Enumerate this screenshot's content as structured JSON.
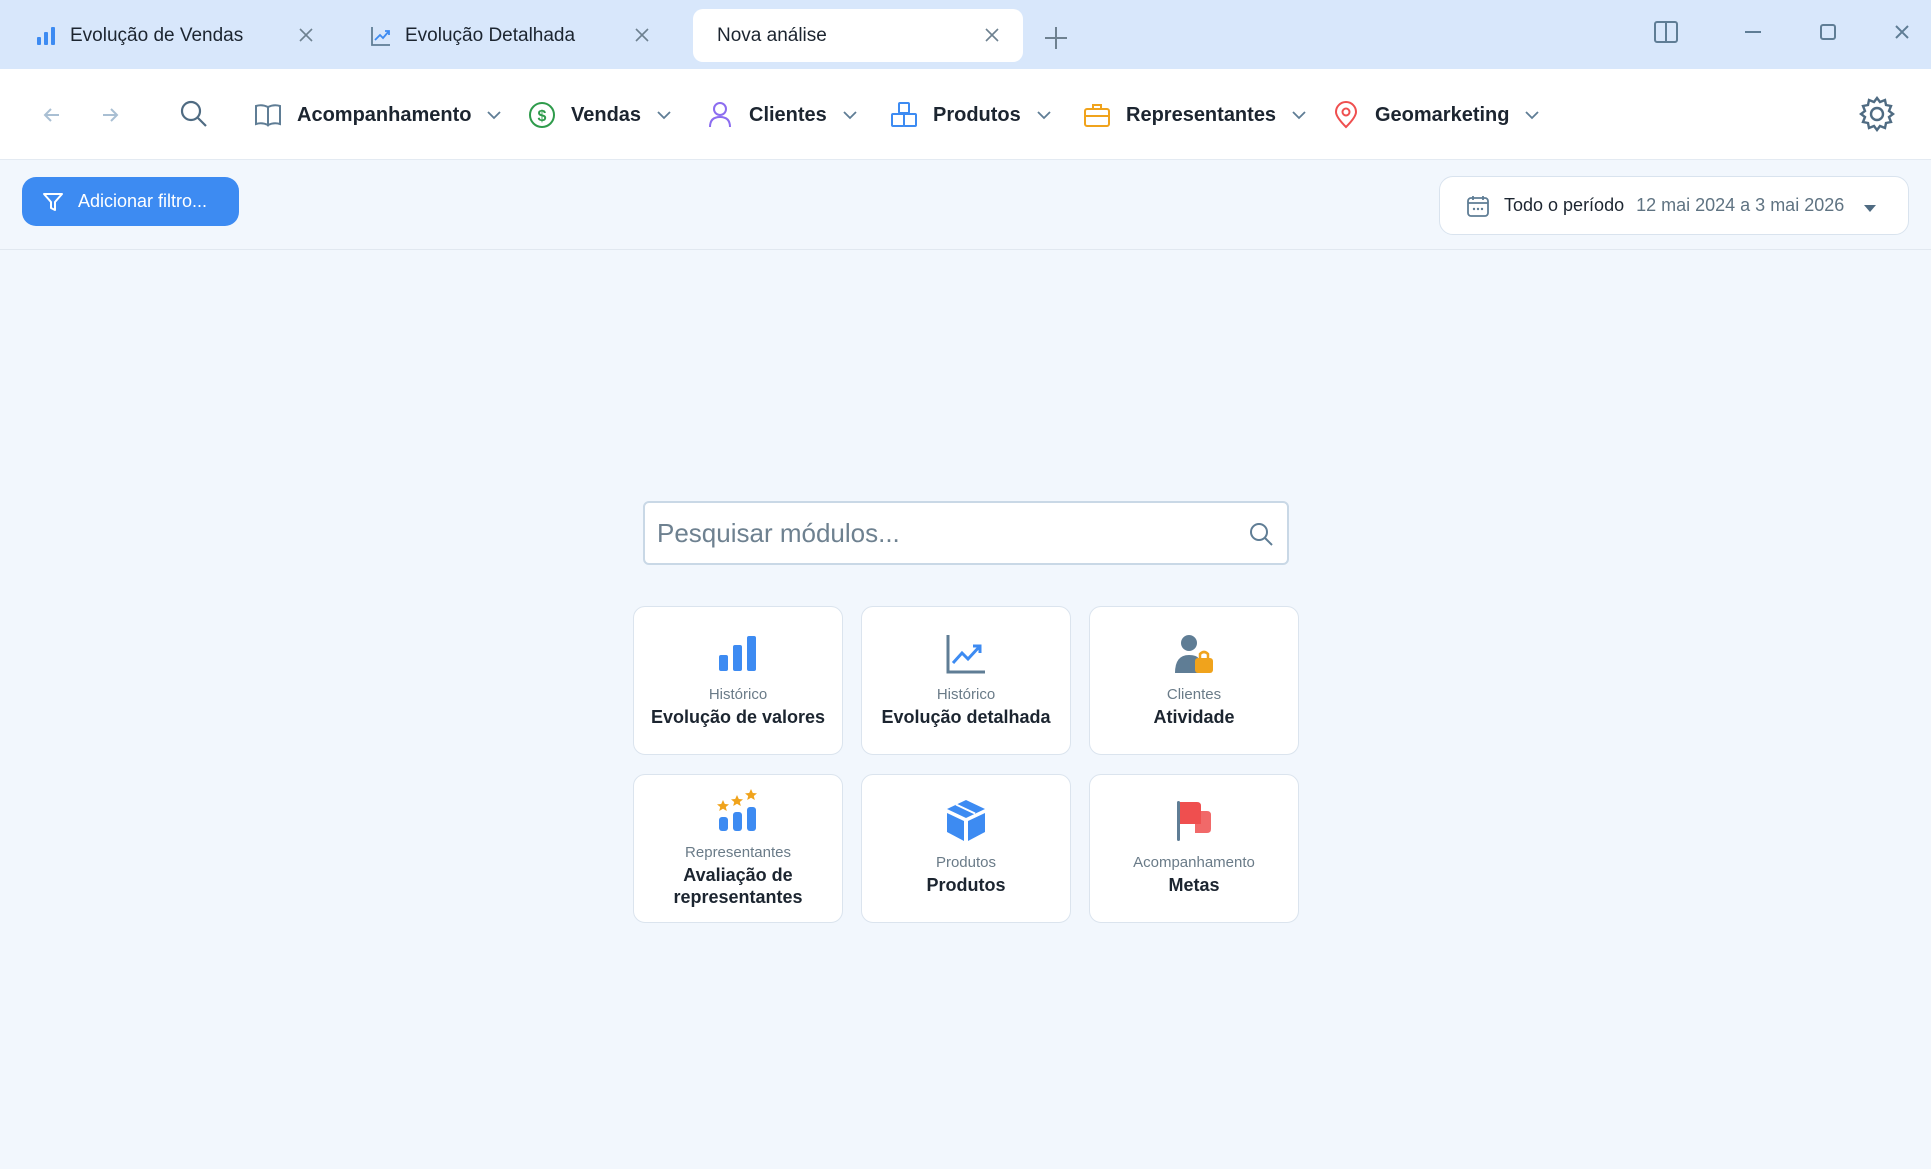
{
  "tabs": [
    {
      "label": "Evolução de Vendas",
      "icon": "bar-chart-icon"
    },
    {
      "label": "Evolução Detalhada",
      "icon": "trend-chart-icon"
    },
    {
      "label": "Nova análise",
      "icon": ""
    }
  ],
  "menus": [
    {
      "label": "Acompanhamento",
      "icon": "book-icon"
    },
    {
      "label": "Vendas",
      "icon": "dollar-circle-icon"
    },
    {
      "label": "Clientes",
      "icon": "user-icon"
    },
    {
      "label": "Produtos",
      "icon": "boxes-icon"
    },
    {
      "label": "Representantes",
      "icon": "briefcase-icon"
    },
    {
      "label": "Geomarketing",
      "icon": "map-pin-icon"
    }
  ],
  "filter": {
    "label": "Adicionar filtro..."
  },
  "period": {
    "label": "Todo o período",
    "range": "12 mai 2024 a 3 mai 2026"
  },
  "search": {
    "placeholder": "Pesquisar módulos..."
  },
  "modules": [
    {
      "category": "Histórico",
      "name": "Evolução de valores",
      "icon": "bar-chart-icon"
    },
    {
      "category": "Histórico",
      "name": "Evolução detalhada",
      "icon": "trend-chart-icon"
    },
    {
      "category": "Clientes",
      "name": "Atividade",
      "icon": "user-bag-icon"
    },
    {
      "category": "Representantes",
      "name": "Avaliação de representantes",
      "icon": "rating-stars-icon"
    },
    {
      "category": "Produtos",
      "name": "Produtos",
      "icon": "box-icon"
    },
    {
      "category": "Acompanhamento",
      "name": "Metas",
      "icon": "flag-icon"
    }
  ],
  "colors": {
    "accent": "#3d8bf2",
    "tabbar_bg": "#d8e7fb",
    "page_bg": "#f2f7fd",
    "vendas_green": "#2e9b4b",
    "clientes_purple": "#8c6df0",
    "produtos_blue": "#3d8bf2",
    "representantes_orange": "#f0a31c",
    "geo_red": "#ef4f4f"
  }
}
